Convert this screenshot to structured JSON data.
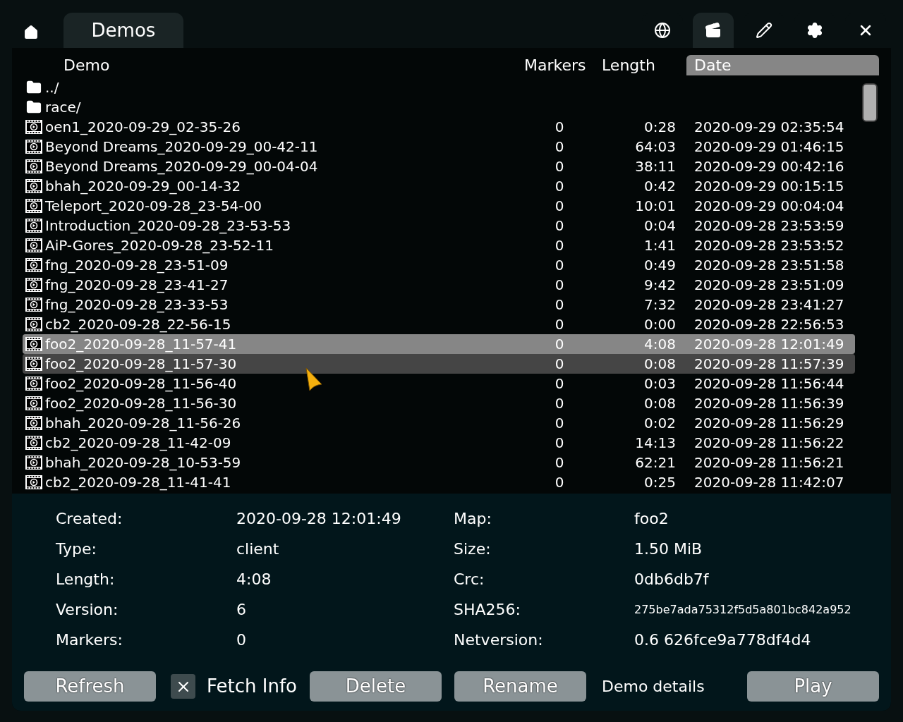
{
  "top_bar": {
    "tab": {
      "label": "Demos",
      "selected": true
    },
    "icons": [
      {
        "kind": "globe",
        "selected": false
      },
      {
        "kind": "film",
        "selected": true
      },
      {
        "kind": "pencil",
        "selected": false
      },
      {
        "kind": "gear",
        "selected": false
      },
      {
        "kind": "close",
        "selected": false
      }
    ]
  },
  "table": {
    "columns": [
      {
        "label": "Demo",
        "selected": false
      },
      {
        "label": "Markers",
        "selected": false
      },
      {
        "label": "Length",
        "selected": false
      },
      {
        "label": "Date",
        "selected": true
      }
    ],
    "rows": [
      {
        "kind": "folder",
        "name": "../",
        "selected": false,
        "hovered": false
      },
      {
        "kind": "folder",
        "name": "race/",
        "selected": false,
        "hovered": false
      },
      {
        "kind": "demo",
        "name": "oen1_2020-09-29_02-35-26",
        "markers": "0",
        "length": "0:28",
        "date": "2020-09-29 02:35:54",
        "selected": false,
        "hovered": false
      },
      {
        "kind": "demo",
        "name": "Beyond Dreams_2020-09-29_00-42-11",
        "markers": "0",
        "length": "64:03",
        "date": "2020-09-29 01:46:15",
        "selected": false,
        "hovered": false
      },
      {
        "kind": "demo",
        "name": "Beyond Dreams_2020-09-29_00-04-04",
        "markers": "0",
        "length": "38:11",
        "date": "2020-09-29 00:42:16",
        "selected": false,
        "hovered": false
      },
      {
        "kind": "demo",
        "name": "bhah_2020-09-29_00-14-32",
        "markers": "0",
        "length": "0:42",
        "date": "2020-09-29 00:15:15",
        "selected": false,
        "hovered": false
      },
      {
        "kind": "demo",
        "name": "Teleport_2020-09-28_23-54-00",
        "markers": "0",
        "length": "10:01",
        "date": "2020-09-29 00:04:04",
        "selected": false,
        "hovered": false
      },
      {
        "kind": "demo",
        "name": "Introduction_2020-09-28_23-53-53",
        "markers": "0",
        "length": "0:04",
        "date": "2020-09-28 23:53:59",
        "selected": false,
        "hovered": false
      },
      {
        "kind": "demo",
        "name": "AiP-Gores_2020-09-28_23-52-11",
        "markers": "0",
        "length": "1:41",
        "date": "2020-09-28 23:53:52",
        "selected": false,
        "hovered": false
      },
      {
        "kind": "demo",
        "name": "fng_2020-09-28_23-51-09",
        "markers": "0",
        "length": "0:49",
        "date": "2020-09-28 23:51:58",
        "selected": false,
        "hovered": false
      },
      {
        "kind": "demo",
        "name": "fng_2020-09-28_23-41-27",
        "markers": "0",
        "length": "9:42",
        "date": "2020-09-28 23:51:09",
        "selected": false,
        "hovered": false
      },
      {
        "kind": "demo",
        "name": "fng_2020-09-28_23-33-53",
        "markers": "0",
        "length": "7:32",
        "date": "2020-09-28 23:41:27",
        "selected": false,
        "hovered": false
      },
      {
        "kind": "demo",
        "name": "cb2_2020-09-28_22-56-15",
        "markers": "0",
        "length": "0:00",
        "date": "2020-09-28 22:56:53",
        "selected": false,
        "hovered": false
      },
      {
        "kind": "demo",
        "name": "foo2_2020-09-28_11-57-41",
        "markers": "0",
        "length": "4:08",
        "date": "2020-09-28 12:01:49",
        "selected": true,
        "hovered": false
      },
      {
        "kind": "demo",
        "name": "foo2_2020-09-28_11-57-30",
        "markers": "0",
        "length": "0:08",
        "date": "2020-09-28 11:57:39",
        "selected": false,
        "hovered": true
      },
      {
        "kind": "demo",
        "name": "foo2_2020-09-28_11-56-40",
        "markers": "0",
        "length": "0:03",
        "date": "2020-09-28 11:56:44",
        "selected": false,
        "hovered": false
      },
      {
        "kind": "demo",
        "name": "foo2_2020-09-28_11-56-30",
        "markers": "0",
        "length": "0:08",
        "date": "2020-09-28 11:56:39",
        "selected": false,
        "hovered": false
      },
      {
        "kind": "demo",
        "name": "bhah_2020-09-28_11-56-26",
        "markers": "0",
        "length": "0:02",
        "date": "2020-09-28 11:56:29",
        "selected": false,
        "hovered": false
      },
      {
        "kind": "demo",
        "name": "cb2_2020-09-28_11-42-09",
        "markers": "0",
        "length": "14:13",
        "date": "2020-09-28 11:56:22",
        "selected": false,
        "hovered": false
      },
      {
        "kind": "demo",
        "name": "bhah_2020-09-28_10-53-59",
        "markers": "0",
        "length": "62:21",
        "date": "2020-09-28 11:56:21",
        "selected": false,
        "hovered": false
      },
      {
        "kind": "demo",
        "name": "cb2_2020-09-28_11-41-41",
        "markers": "0",
        "length": "0:25",
        "date": "2020-09-28 11:42:07",
        "selected": false,
        "hovered": false
      }
    ]
  },
  "details": {
    "left": [
      {
        "label": "Created:",
        "value": "2020-09-28 12:01:49",
        "kind": "text"
      },
      {
        "label": "Type:",
        "value": "client",
        "kind": "text"
      },
      {
        "label": "Length:",
        "value": "4:08",
        "kind": "text"
      },
      {
        "label": "Version:",
        "value": "6",
        "kind": "text"
      },
      {
        "label": "Markers:",
        "value": "0",
        "kind": "text"
      }
    ],
    "right": [
      {
        "label": "Map:",
        "value": "foo2",
        "kind": "text"
      },
      {
        "label": "Size:",
        "value": "1.50 MiB",
        "kind": "text"
      },
      {
        "label": "Crc:",
        "value": "0db6db7f",
        "kind": "text"
      },
      {
        "label": "SHA256:",
        "value": "275be7ada75312f5d5a801bc842a952",
        "kind": "hash"
      },
      {
        "label": "Netversion:",
        "value": "0.6 626fce9a778df4d4",
        "kind": "text"
      }
    ]
  },
  "bottom_bar": [
    {
      "kind": "button",
      "label": "Refresh"
    },
    {
      "kind": "checkbox",
      "label": "Fetch Info",
      "checked": true
    },
    {
      "kind": "button",
      "label": "Delete"
    },
    {
      "kind": "button",
      "label": "Rename"
    },
    {
      "kind": "text",
      "label": "Demo details"
    },
    {
      "kind": "button",
      "label": "Play"
    }
  ]
}
